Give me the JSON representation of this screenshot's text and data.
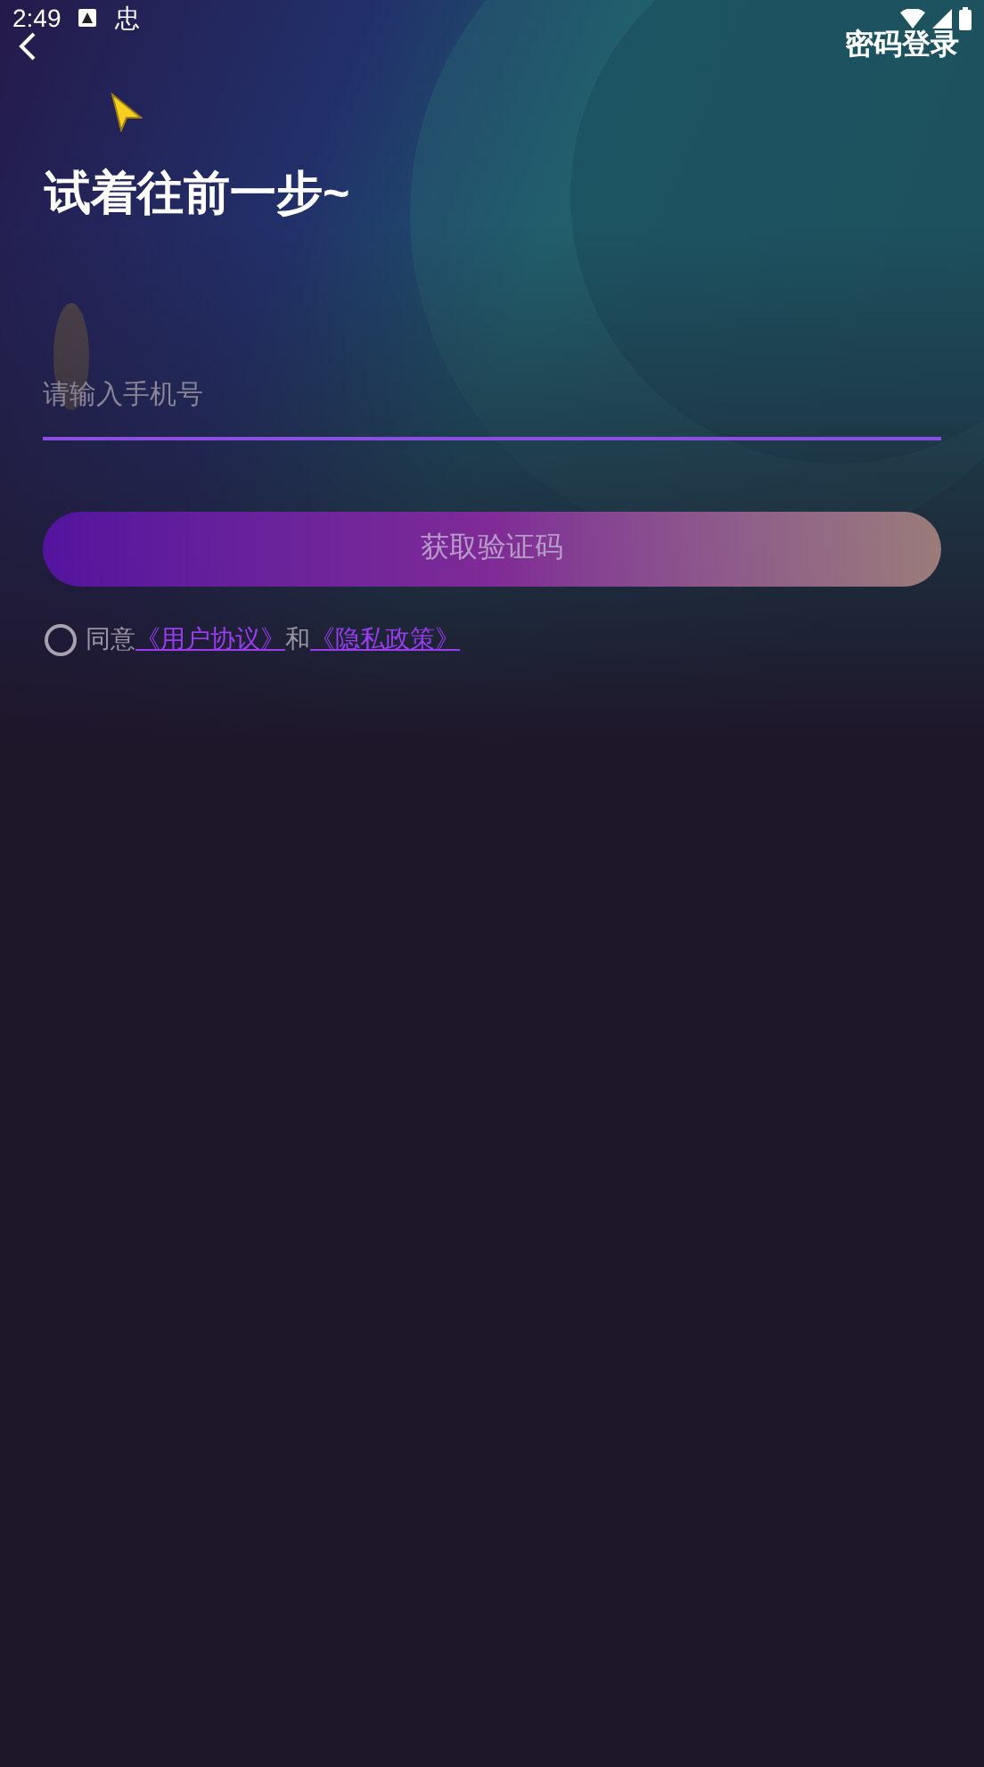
{
  "status_bar": {
    "time": "2:49",
    "notification": "忠"
  },
  "header": {
    "action": "密码登录"
  },
  "title": "试着往前一步~",
  "phone_field": {
    "placeholder": "请输入手机号"
  },
  "submit_button": {
    "label": "获取验证码",
    "disabled": true
  },
  "agreement": {
    "checked": false,
    "prefix": "同意",
    "links": [
      {
        "text": "《用户协议》"
      },
      {
        "text": "《隐私政策》"
      }
    ],
    "joiner": "和"
  }
}
